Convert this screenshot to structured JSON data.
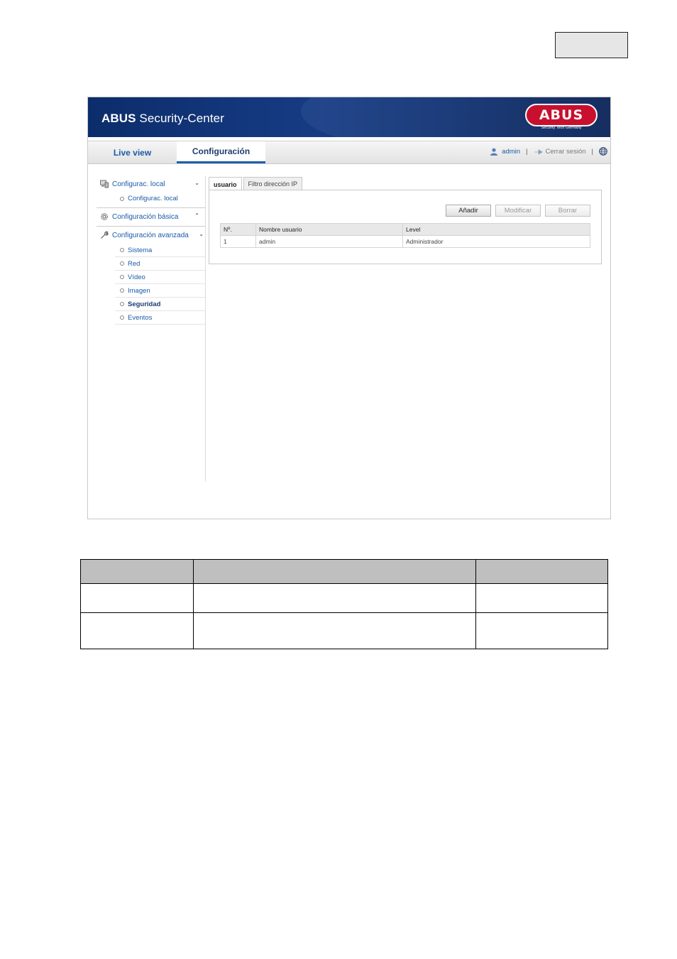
{
  "banner": {
    "title_bold": "ABUS",
    "title_rest": " Security-Center",
    "logo_text": "ABUS",
    "logo_subtitle": "Security Tech Germany"
  },
  "nav": {
    "tabs": [
      {
        "label": "Live view",
        "active": false
      },
      {
        "label": "Configuración",
        "active": true
      }
    ],
    "user": "admin",
    "logout": "Cerrar sesión",
    "separator": "|"
  },
  "sidebar": {
    "local": {
      "label": "Configurac. local",
      "chevron": "⌄",
      "items": [
        "Configurac. local"
      ]
    },
    "basic": {
      "label": "Configuración básica",
      "chevron": "⌃"
    },
    "advanced": {
      "label": "Configuración avanzada",
      "chevron": "⌄",
      "items": [
        {
          "label": "Sistema",
          "active": false
        },
        {
          "label": "Red",
          "active": false
        },
        {
          "label": "Vídeo",
          "active": false
        },
        {
          "label": "Imagen",
          "active": false
        },
        {
          "label": "Seguridad",
          "active": true
        },
        {
          "label": "Eventos",
          "active": false
        }
      ]
    }
  },
  "content": {
    "tabs": [
      {
        "label": "usuario",
        "active": true
      },
      {
        "label": "Filtro dirección IP",
        "active": false
      }
    ],
    "buttons": {
      "add": "Añadir",
      "modify": "Modificar",
      "delete": "Borrar"
    },
    "table": {
      "headers": [
        "Nº.",
        "Nombre usuario",
        "Level"
      ],
      "rows": [
        [
          "1",
          "admin",
          "Administrador"
        ]
      ]
    }
  },
  "colors": {
    "brand_red": "#c8102e",
    "banner_blue": "#173c85",
    "link_blue": "#1a5aa8"
  }
}
